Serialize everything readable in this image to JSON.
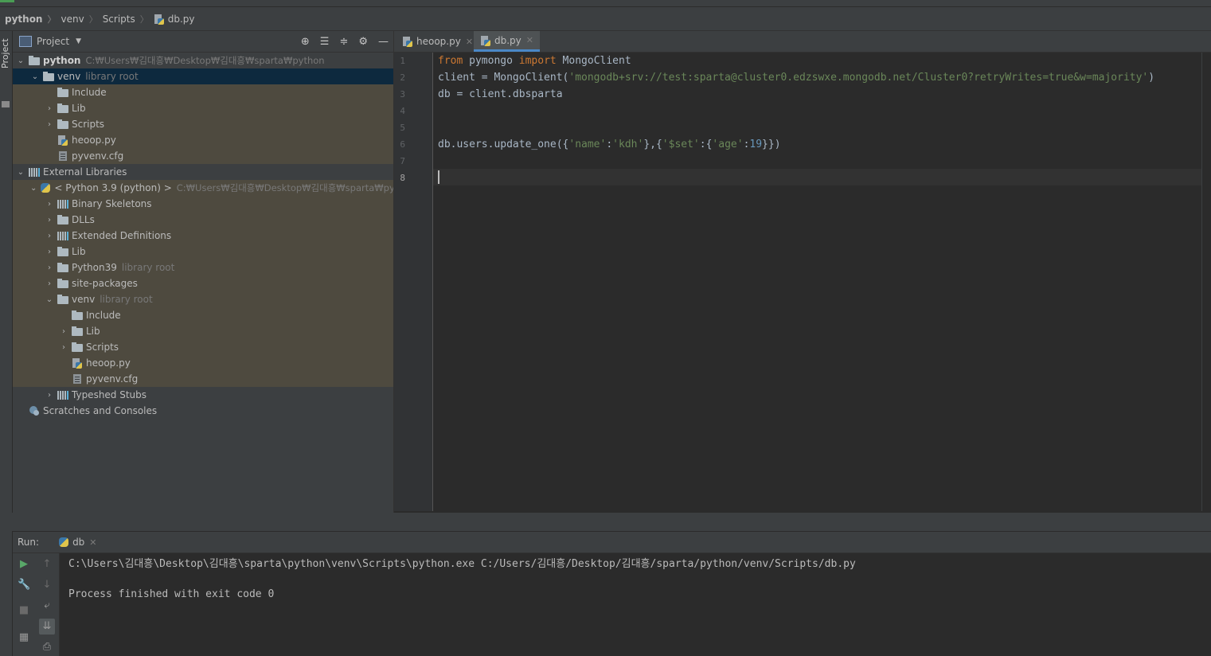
{
  "breadcrumbs": [
    {
      "label": "python"
    },
    {
      "label": "venv"
    },
    {
      "label": "Scripts"
    },
    {
      "label": "db.py"
    }
  ],
  "sidebar_tool_window": "Project",
  "project_panel": {
    "title": "Project",
    "tree": [
      {
        "label": "python",
        "hint": "C:₩Users₩김대흥₩Desktop₩김대흥₩sparta₩python"
      },
      {
        "label": "venv",
        "hint": "library root"
      },
      {
        "label": "Include"
      },
      {
        "label": "Lib"
      },
      {
        "label": "Scripts"
      },
      {
        "label": "heoop.py"
      },
      {
        "label": "pyvenv.cfg"
      },
      {
        "label": "External Libraries"
      },
      {
        "label": "< Python 3.9 (python) >",
        "hint": "C:₩Users₩김대흥₩Desktop₩김대흥₩sparta₩python"
      },
      {
        "label": "Binary Skeletons"
      },
      {
        "label": "DLLs"
      },
      {
        "label": "Extended Definitions"
      },
      {
        "label": "Lib"
      },
      {
        "label": "Python39",
        "hint": "library root"
      },
      {
        "label": "site-packages"
      },
      {
        "label": "venv",
        "hint": "library root"
      },
      {
        "label": "Include"
      },
      {
        "label": "Lib"
      },
      {
        "label": "Scripts"
      },
      {
        "label": "heoop.py"
      },
      {
        "label": "pyvenv.cfg"
      },
      {
        "label": "Typeshed Stubs"
      },
      {
        "label": "Scratches and Consoles"
      }
    ]
  },
  "editor": {
    "tabs": [
      {
        "label": "heoop.py",
        "active": false
      },
      {
        "label": "db.py",
        "active": true
      }
    ],
    "line_numbers": [
      "1",
      "2",
      "3",
      "4",
      "5",
      "6",
      "7",
      "8"
    ],
    "current_line": "8",
    "lines": {
      "l1": {
        "kw1": "from",
        "t1": " pymongo ",
        "kw2": "import",
        "t2": " MongoClient"
      },
      "l2": {
        "t1": "client = MongoClient(",
        "s1": "'mongodb+srv://test:sparta@cluster0.edzswxe.mongodb.net/Cluster0?retryWrites=true&w=majority'",
        "t2": ")"
      },
      "l3": {
        "t1": "db = client.dbsparta"
      },
      "l6": {
        "t1": "db.users.update_one({",
        "s1": "'name'",
        "t2": ":",
        "s2": "'kdh'",
        "t3": "},{",
        "s3": "'$set'",
        "t4": ":{",
        "s4": "'age'",
        "t5": ":",
        "n1": "19",
        "t6": "}})"
      }
    }
  },
  "run_panel": {
    "label": "Run:",
    "tab_label": "db",
    "console_lines": [
      "C:\\Users\\김대흥\\Desktop\\김대흥\\sparta\\python\\venv\\Scripts\\python.exe C:/Users/김대흥/Desktop/김대흥/sparta/python/venv/Scripts/db.py",
      "",
      "Process finished with exit code 0"
    ]
  },
  "colors": {
    "keyword": "#cc7832",
    "string": "#6a8759",
    "number": "#6897bb",
    "selection": "#0d293e",
    "library_root_bg": "#4e4a3f",
    "tab_underline": "#4a88c7"
  }
}
